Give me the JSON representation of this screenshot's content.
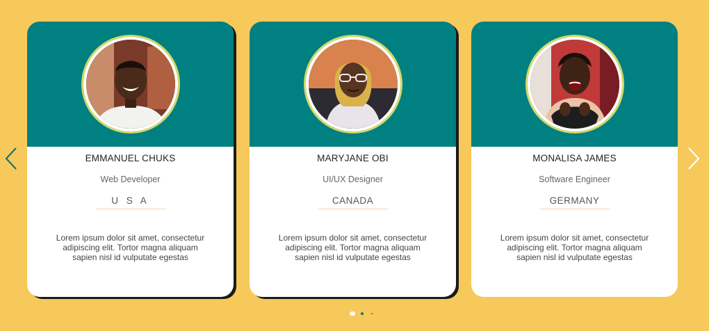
{
  "colors": {
    "background": "#f7c95a",
    "card_header": "#008080",
    "card_body": "#ffffff",
    "arrow_left": "#1f6f6f",
    "arrow_right": "#ffffff"
  },
  "cards": [
    {
      "name": "EMMANUEL CHUKS",
      "role": "Web Developer",
      "country": "U S A",
      "bio": "Lorem ipsum dolor sit amet, consectetur adipiscing elit. Tortor magna aliquam sapien nisl id vulputate egestas",
      "avatar": "man-smiling-photo"
    },
    {
      "name": "MARYJANE OBI",
      "role": "UI/UX Designer",
      "country": "CANADA",
      "bio": "Lorem ipsum dolor sit amet, consectetur adipiscing elit. Tortor magna aliquam sapien nisl id vulputate egestas",
      "avatar": "woman-with-glasses-photo"
    },
    {
      "name": "MONALISA JAMES",
      "role": "Software Engineer",
      "country": "GERMANY",
      "bio": "Lorem ipsum dolor sit amet, consectetur adipiscing elit. Tortor magna aliquam sapien nisl id vulputate egestas",
      "avatar": "woman-laughing-photo"
    }
  ],
  "navigation": {
    "prev_icon": "chevron-left-icon",
    "next_icon": "chevron-right-icon"
  },
  "pagination": {
    "page_count": 3,
    "active_index": 0
  }
}
